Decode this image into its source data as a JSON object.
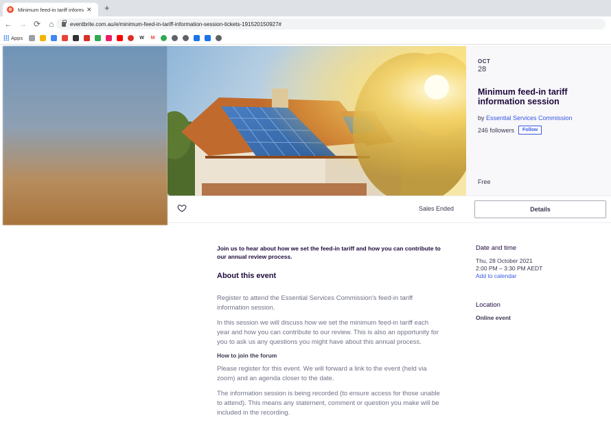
{
  "browser": {
    "tab_title": "Minimum feed-in tariff informati",
    "tab_favicon_letter": "e",
    "url": "eventbrite.com.au/e/minimum-feed-in-tariff-information-session-tickets-191520150927#",
    "apps_label": "Apps",
    "bookmarks": [
      {
        "label": "",
        "color": "#9aa0a6",
        "icon": "sync-icon"
      },
      {
        "label": "",
        "color": "#f4b400",
        "icon": "plane-icon"
      },
      {
        "label": "",
        "color": "#4285f4",
        "icon": "microsoft-icon"
      },
      {
        "label": "",
        "color": "#ea4335",
        "icon": "maps-pin-icon"
      },
      {
        "label": "",
        "color": "#333333",
        "icon": "chart-icon"
      },
      {
        "label": "",
        "color": "#d93025",
        "icon": "red-square-icon"
      },
      {
        "label": "",
        "color": "#34a853",
        "icon": "drive-icon"
      },
      {
        "label": "",
        "color": "#e91e63",
        "icon": "pink-square-icon"
      },
      {
        "label": "",
        "color": "#ff0000",
        "icon": "youtube-icon"
      },
      {
        "label": "",
        "color": "#d93025",
        "icon": "circle-icon"
      },
      {
        "label": "W",
        "color": "#333333",
        "icon": "w-icon"
      },
      {
        "label": "M",
        "color": "#ea4335",
        "icon": "gmail-icon"
      },
      {
        "label": "",
        "color": "#34a853",
        "icon": "green-circle-icon"
      },
      {
        "label": "",
        "color": "#5f6368",
        "icon": "globe-icon"
      },
      {
        "label": "",
        "color": "#5f6368",
        "icon": "globe-icon"
      },
      {
        "label": "",
        "color": "#1a73e8",
        "icon": "blue-icon"
      },
      {
        "label": "",
        "color": "#1a73e8",
        "icon": "diamond-icon"
      },
      {
        "label": "",
        "color": "#5f6368",
        "icon": "globe-icon"
      }
    ]
  },
  "event": {
    "month": "OCT",
    "day": "28",
    "title": "Minimum feed-in tariff information session",
    "by_prefix": "by ",
    "organizer": "Essential Services Commission",
    "followers": "246 followers",
    "follow_label": "Follow",
    "price": "Free"
  },
  "actions": {
    "status": "Sales Ended",
    "details_label": "Details"
  },
  "description": {
    "summary": "Join us to hear about how we set the feed-in tariff and how you can contribute to our annual review process.",
    "about_heading": "About this event",
    "para1": "Register to attend the Essential Services Commission's feed-in tariff information session.",
    "para2": "In this session we will discuss how we set the minimum feed-in tariff each year and how you can contribute to our review. This is also an opportunity for you to ask us any questions you might have about this annual process.",
    "how_heading": "How to join the forum",
    "para3": "Please register for this event. We will forward a link to the event (held via zoom) and an agenda closer to the date.",
    "para4": "The information session is being recorded (to ensure access for those unable to attend). This means any statement, comment or question you make will be included in the recording."
  },
  "sidebar": {
    "date_heading": "Date and time",
    "date_line": "Thu, 28 October 2021",
    "time_line": "2:00 PM – 3:30 PM AEDT",
    "calendar_link": "Add to calendar",
    "location_heading": "Location",
    "location_text": "Online event"
  },
  "colors": {
    "brand": "#f05537",
    "link": "#3659e3",
    "title": "#1e0a3c"
  }
}
